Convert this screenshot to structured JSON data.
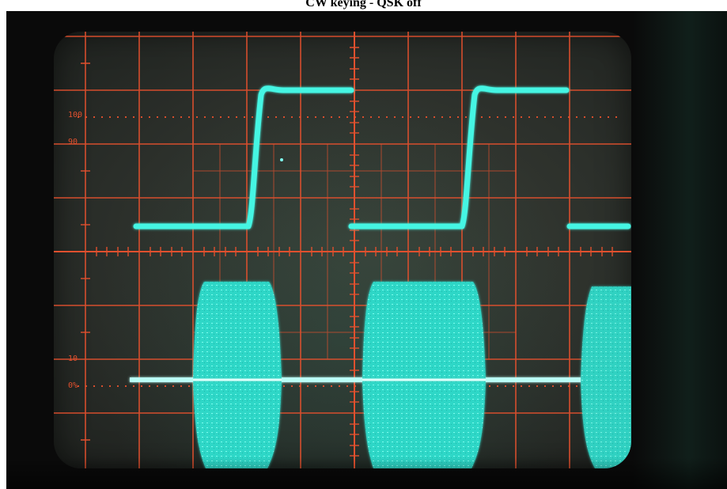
{
  "caption": "CW keying - QSK off",
  "graticule": {
    "labels": {
      "top_100": "100",
      "top_90": "90",
      "bottom_10": "10",
      "bottom_0": "0%"
    },
    "color": "#e0502e"
  },
  "traces": {
    "color": "#3ff2e0",
    "keying_waveform": "square",
    "rf_envelope": "bursts"
  }
}
